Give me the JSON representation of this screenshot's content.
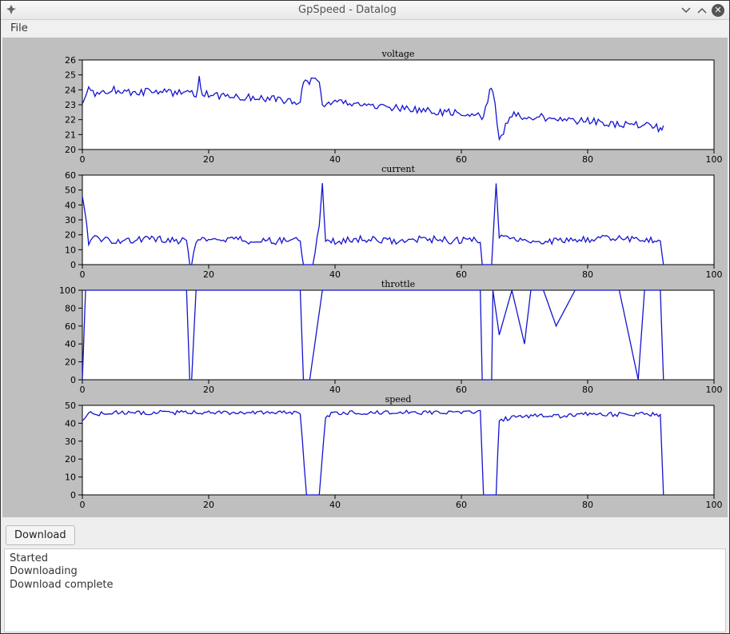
{
  "window": {
    "title": "GpSpeed - Datalog"
  },
  "menubar": {
    "file": "File"
  },
  "buttons": {
    "download": "Download"
  },
  "log": {
    "line1": "Started",
    "line2": "Downloading",
    "line3": "Download complete"
  },
  "chart_data": [
    {
      "type": "line",
      "title": "voltage",
      "xlabel": "",
      "ylabel": "",
      "xlim": [
        0,
        100
      ],
      "ylim": [
        20,
        26
      ],
      "yticks": [
        20,
        21,
        22,
        23,
        24,
        25,
        26
      ],
      "xticks": [
        0,
        20,
        40,
        60,
        80,
        100
      ],
      "series": [
        {
          "name": "voltage",
          "x": [
            0,
            1,
            2,
            5,
            8,
            12,
            18,
            18.5,
            19,
            25,
            30,
            34.5,
            35,
            37.5,
            38,
            40,
            45,
            50,
            55,
            60,
            63,
            63.5,
            64.5,
            65,
            66,
            68,
            72,
            76,
            80,
            85,
            90,
            91.5,
            92
          ],
          "values": [
            23.2,
            24.0,
            23.8,
            24.0,
            23.8,
            23.9,
            23.7,
            24.8,
            23.7,
            23.5,
            23.4,
            23.2,
            24.6,
            24.6,
            23.0,
            23.1,
            23.0,
            22.8,
            22.6,
            22.4,
            22.3,
            22.2,
            24.0,
            24.0,
            20.7,
            22.3,
            22.2,
            22.0,
            21.9,
            21.7,
            21.6,
            21.4,
            21.6
          ]
        }
      ]
    },
    {
      "type": "line",
      "title": "current",
      "xlabel": "",
      "ylabel": "",
      "xlim": [
        0,
        100
      ],
      "ylim": [
        0,
        60
      ],
      "yticks": [
        0,
        10,
        20,
        30,
        40,
        50,
        60
      ],
      "xticks": [
        0,
        20,
        40,
        60,
        80,
        100
      ],
      "series": [
        {
          "name": "current",
          "x": [
            0,
            1,
            2,
            5,
            10,
            16.5,
            17,
            17.3,
            18,
            22,
            28,
            34.5,
            35,
            36.5,
            37.5,
            38,
            38.5,
            40,
            45,
            50,
            55,
            60,
            63,
            63.3,
            64.8,
            65.5,
            66,
            70,
            75,
            80,
            85,
            90,
            91.5,
            92
          ],
          "values": [
            47,
            15,
            17,
            16,
            17,
            16,
            0,
            0,
            16,
            17,
            16,
            16,
            0,
            0,
            25,
            54,
            17,
            16,
            17,
            16,
            17,
            16,
            17,
            0,
            0,
            55,
            18,
            17,
            16,
            17,
            18,
            17,
            16,
            0
          ]
        }
      ]
    },
    {
      "type": "line",
      "title": "throttle",
      "xlabel": "",
      "ylabel": "",
      "xlim": [
        0,
        100
      ],
      "ylim": [
        0,
        100
      ],
      "yticks": [
        0,
        20,
        40,
        60,
        80,
        100
      ],
      "xticks": [
        0,
        20,
        40,
        60,
        80,
        100
      ],
      "series": [
        {
          "name": "throttle",
          "x": [
            0,
            0.5,
            1,
            5,
            10,
            16.5,
            17,
            17.3,
            18,
            22,
            28,
            34.5,
            35,
            36,
            37,
            38,
            40,
            45,
            50,
            55,
            60,
            63,
            63.3,
            64.8,
            65,
            66,
            68,
            70,
            71,
            73,
            75,
            78,
            80,
            85,
            88,
            89,
            90,
            91.5,
            92
          ],
          "values": [
            0,
            100,
            100,
            100,
            100,
            100,
            0,
            0,
            100,
            100,
            100,
            100,
            0,
            0,
            50,
            100,
            100,
            100,
            100,
            100,
            100,
            100,
            0,
            0,
            100,
            50,
            100,
            40,
            100,
            100,
            60,
            100,
            100,
            100,
            0,
            100,
            100,
            100,
            0
          ]
        }
      ]
    },
    {
      "type": "line",
      "title": "speed",
      "xlabel": "",
      "ylabel": "",
      "xlim": [
        0,
        100
      ],
      "ylim": [
        0,
        50
      ],
      "yticks": [
        0,
        10,
        20,
        30,
        40,
        50
      ],
      "xticks": [
        0,
        20,
        40,
        60,
        80,
        100
      ],
      "series": [
        {
          "name": "speed",
          "x": [
            0,
            1,
            2,
            5,
            10,
            15,
            20,
            25,
            30,
            34.5,
            35.5,
            37.5,
            38.5,
            40,
            45,
            50,
            55,
            60,
            63,
            63.5,
            65.5,
            66,
            70,
            75,
            80,
            85,
            90,
            91.5,
            92
          ],
          "values": [
            42,
            46,
            45,
            46,
            46,
            46,
            46,
            46,
            46,
            46,
            0,
            0,
            44,
            46,
            46,
            46,
            46,
            46,
            46,
            0,
            0,
            42,
            44,
            44,
            45,
            45,
            45,
            45,
            0
          ]
        }
      ]
    }
  ]
}
